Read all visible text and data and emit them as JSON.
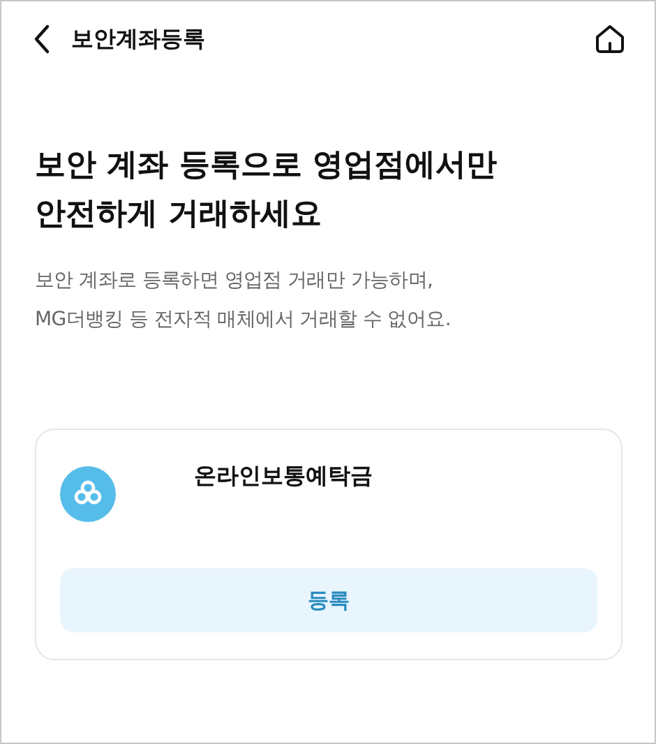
{
  "header": {
    "title": "보안계좌등록"
  },
  "headline": [
    "보안 계좌 등록으로 영업점에서만",
    "안전하게 거래하세요"
  ],
  "description": [
    "보안 계좌로 등록하면 영업점 거래만 가능하며,",
    "MG더뱅킹 등 전자적 매체에서 거래할 수 없어요."
  ],
  "accounts": [
    {
      "name": "온라인보통예탁금",
      "button": "등록"
    }
  ]
}
